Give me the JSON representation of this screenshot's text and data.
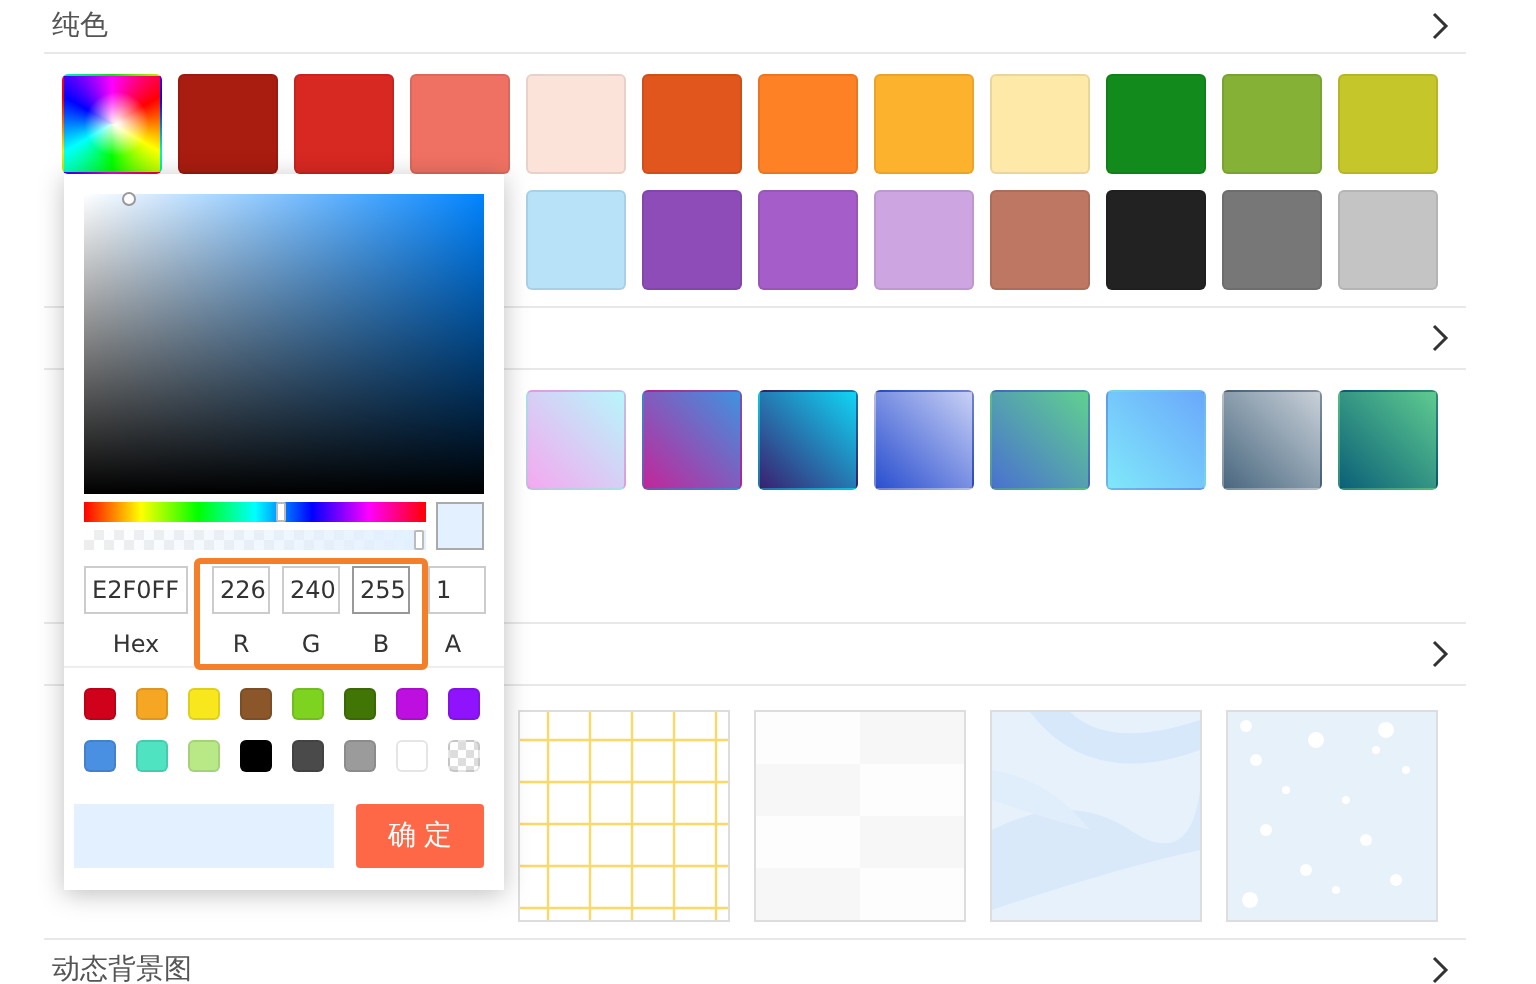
{
  "sections": [
    {
      "title": "纯色",
      "kind": "swatches",
      "rows": [
        [
          {
            "kind": "rainbow"
          },
          {
            "kind": "solid",
            "color": "#a91c10"
          },
          {
            "kind": "solid",
            "color": "#d82822"
          },
          {
            "kind": "solid",
            "color": "#ef7163"
          },
          {
            "kind": "solid",
            "color": "#fce3da"
          },
          {
            "kind": "solid",
            "color": "#e1561c"
          },
          {
            "kind": "solid",
            "color": "#fe8126"
          },
          {
            "kind": "solid",
            "color": "#fdb22d"
          },
          {
            "kind": "solid",
            "color": "#fee9a9"
          },
          {
            "kind": "solid",
            "color": "#138b1c"
          },
          {
            "kind": "solid",
            "color": "#84b136"
          },
          {
            "kind": "solid",
            "color": "#c4c62a"
          }
        ],
        [
          {
            "kind": "solid",
            "color": "#b8e2f8"
          },
          {
            "kind": "solid",
            "color": "#8e4cb9"
          },
          {
            "kind": "solid",
            "color": "#a55ec9"
          },
          {
            "kind": "solid",
            "color": "#cda5e0"
          },
          {
            "kind": "solid",
            "color": "#bd7763"
          },
          {
            "kind": "solid",
            "color": "#222222"
          },
          {
            "kind": "solid",
            "color": "#777777"
          },
          {
            "kind": "solid",
            "color": "#c4c4c4"
          }
        ]
      ]
    },
    {
      "kind": "gradients",
      "rows": [
        [
          {
            "kind": "gradient"
          },
          {
            "kind": "gradient"
          },
          {
            "kind": "gradient"
          },
          {
            "kind": "gradient"
          },
          {
            "kind": "gradient"
          },
          {
            "kind": "gradient"
          },
          {
            "kind": "gradient"
          },
          {
            "kind": "gradient"
          }
        ]
      ]
    },
    {
      "kind": "textures",
      "tiles": [
        {
          "kind": "grid"
        },
        {
          "kind": "checker"
        },
        {
          "kind": "marble"
        },
        {
          "kind": "snow"
        }
      ]
    },
    {
      "title": "动态背景图",
      "kind": "empty"
    }
  ],
  "picker": {
    "hue": {
      "level": 0.58
    },
    "alpha": {
      "level": 1
    },
    "preview": {
      "color": "#e2f0ff"
    },
    "fields": [
      {
        "label": "Hex",
        "value": "E2F0FF",
        "focused": false
      },
      {
        "label": "R",
        "value": "226",
        "focused": false
      },
      {
        "label": "G",
        "value": "240",
        "focused": false
      },
      {
        "label": "B",
        "value": "255",
        "focused": true
      },
      {
        "label": "A",
        "value": "1",
        "focused": false
      }
    ],
    "rgb_highlighted": true,
    "presets": [
      {
        "kind": "solid",
        "color": "#d0021b"
      },
      {
        "kind": "solid",
        "color": "#f5a623"
      },
      {
        "kind": "solid",
        "color": "#f8e71c"
      },
      {
        "kind": "solid",
        "color": "#8b572a"
      },
      {
        "kind": "solid",
        "color": "#7ed321"
      },
      {
        "kind": "solid",
        "color": "#417505"
      },
      {
        "kind": "solid",
        "color": "#bd10e0"
      },
      {
        "kind": "solid",
        "color": "#9013fe"
      },
      {
        "kind": "solid",
        "color": "#4a90e2"
      },
      {
        "kind": "solid",
        "color": "#50e3c2"
      },
      {
        "kind": "solid",
        "color": "#b8e986"
      },
      {
        "kind": "solid",
        "color": "#000000"
      },
      {
        "kind": "solid",
        "color": "#4a4a4a"
      },
      {
        "kind": "solid",
        "color": "#9b9b9b"
      },
      {
        "kind": "solid",
        "color": "#ffffff"
      },
      {
        "kind": "transparent"
      }
    ],
    "confirm": "确 定"
  }
}
